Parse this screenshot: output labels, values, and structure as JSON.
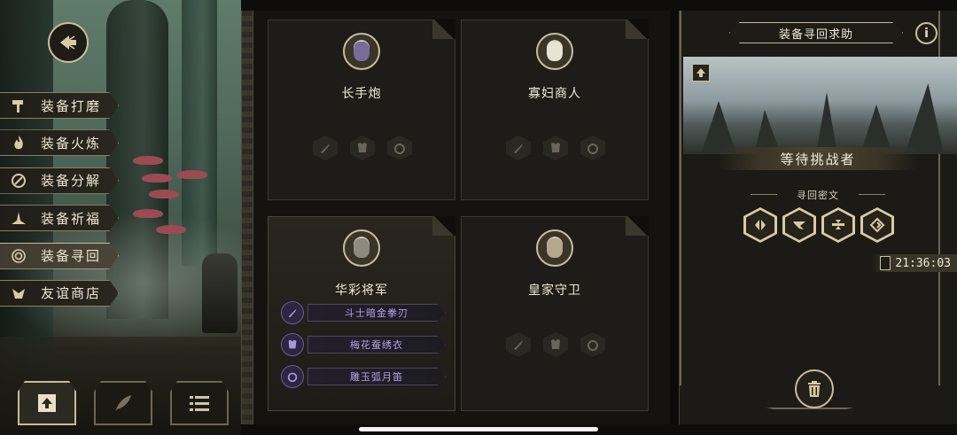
{
  "colors": {
    "gold": "#c9bb95",
    "panel": "#1d1c19",
    "reward_text": "#b3a3e8"
  },
  "menu": {
    "items": [
      {
        "label": "装备打磨",
        "icon": "hammer-icon",
        "active": false
      },
      {
        "label": "装备火炼",
        "icon": "flame-icon",
        "active": false
      },
      {
        "label": "装备分解",
        "icon": "disassemble-icon",
        "active": false
      },
      {
        "label": "装备祈福",
        "icon": "blessing-icon",
        "active": false
      },
      {
        "label": "装备寻回",
        "icon": "retrieve-icon",
        "active": true
      },
      {
        "label": "友谊商店",
        "icon": "shop-icon",
        "active": false
      }
    ]
  },
  "bottom_tabs": [
    {
      "icon": "upload-icon",
      "active": true
    },
    {
      "icon": "feather-icon",
      "active": false
    },
    {
      "icon": "list-icon",
      "active": false
    }
  ],
  "cards": [
    {
      "name": "长手炮"
    },
    {
      "name": "寡妇商人"
    },
    {
      "name": "华彩将军",
      "rewards": [
        "斗士暗金拳刃",
        "梅花蚕绣衣",
        "雕玉弧月笛"
      ]
    },
    {
      "name": "皇家守卫"
    }
  ],
  "right": {
    "title": "装备寻回求助",
    "info": "i",
    "status": "等待挑战者",
    "cipher_label": "寻回密文",
    "runes": [
      "rune-1-icon",
      "rune-2-icon",
      "rune-3-icon",
      "rune-4-icon"
    ],
    "timer": "21:36:03"
  }
}
